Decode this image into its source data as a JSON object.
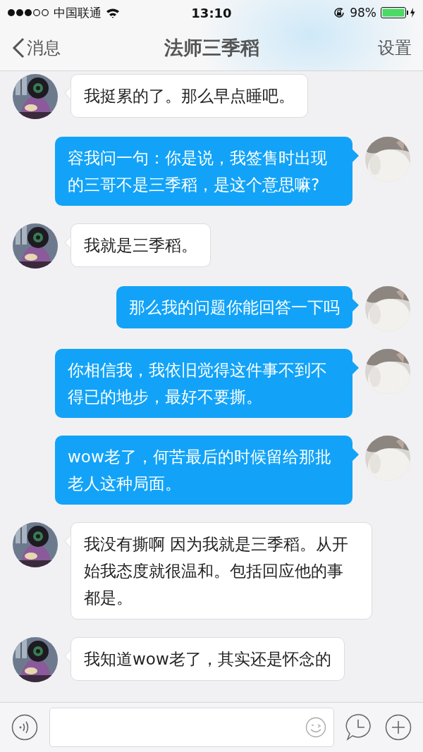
{
  "status_bar": {
    "carrier": "中国联通",
    "time": "13:10",
    "battery": "98%"
  },
  "nav": {
    "back": "消息",
    "title": "法师三季稻",
    "action": "设置"
  },
  "messages": [
    {
      "kind": "received",
      "text": "我挺累的了。那么早点睡吧。"
    },
    {
      "kind": "sent",
      "text": "容我问一句：你是说，我签售时出现的三哥不是三季稻，是这个意思嘛?"
    },
    {
      "kind": "received",
      "text": "我就是三季稻。"
    },
    {
      "kind": "sent",
      "text": "那么我的问题你能回答一下吗"
    },
    {
      "kind": "sent",
      "text": "你相信我，我依旧觉得这件事不到不得已的地步，最好不要撕。"
    },
    {
      "kind": "sent",
      "text": "wow老了，何苦最后的时候留给那批老人这种局面。"
    },
    {
      "kind": "received",
      "text": "我没有撕啊 因为我就是三季稻。从开始我态度就很温和。包括回应他的事都是。"
    },
    {
      "kind": "received",
      "text": "我知道wow老了，其实还是怀念的"
    }
  ]
}
